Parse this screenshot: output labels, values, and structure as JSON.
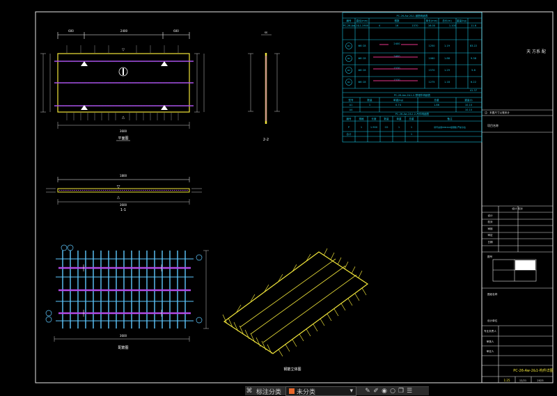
{
  "drawing": {
    "view_titles": {
      "plan": "平面图",
      "section_22": "2-2",
      "section_11": "1-1",
      "rebar_plan": "配筋图",
      "iso": "钢筋立体图"
    },
    "plan_dims": {
      "top_left": "600",
      "top_mid": "2400",
      "top_right": "600",
      "bottom": "3600"
    },
    "section_11_dims": {
      "top": "1800",
      "bottom": "3600"
    },
    "rebar_dims": {
      "bottom": "3600"
    },
    "right_note": "天 方系 配"
  },
  "schedule": {
    "title1": "PC-26-Aw-2&1-钢筋明细表",
    "headers1": [
      "编号",
      "直径(mm)",
      "根数",
      "单长(mm)",
      "总长(m)",
      "重量(kg)"
    ],
    "row0": [
      "PC-26-Aw-2&1-1900",
      "4",
      "16",
      "1570",
      "16.00",
      "1.100",
      "11.6"
    ],
    "rows": [
      {
        "id": "Φ1",
        "spec": "Φ8 C8",
        "len": "2400",
        "n": "1250",
        "w": "1.19",
        "x": "83.22"
      },
      {
        "id": "Φ2",
        "spec": "Φ8 C8",
        "len": "2400",
        "n": "1060",
        "w": "1.88",
        "x": "9.38"
      },
      {
        "id": "Φ3",
        "spec": "Φ8 C8",
        "len": "1570",
        "n": "1570",
        "w": "1.29",
        "x": "5.8"
      },
      {
        "id": "Φ4",
        "spec": "Φ8 C8",
        "len": "1570",
        "n": "1275",
        "w": "1.18",
        "x": "6.22"
      }
    ],
    "total": "41.37",
    "title2": "PC-26-Aw-2&1-2-预埋件明细表",
    "headers2": [
      "型号",
      "数量",
      "单重(kg)",
      "总重",
      "体积(m³)",
      "重量(t)"
    ],
    "row2": [
      "A1",
      "1",
      "0.74",
      "1.86",
      "1.86",
      "10.10"
    ],
    "row2b": [
      "A4",
      "",
      "",
      "",
      "",
      "10.10"
    ],
    "title3": "PC-26-Aw-2&1-2-吊件明细表",
    "headers3": [
      "编号",
      "规格",
      "长度",
      "数量",
      "单重",
      "总重",
      "备注"
    ],
    "row3": [
      "P",
      "1",
      "1.900",
      "C0",
      "1",
      "1",
      "吊环采用HPB300级钢筋,严禁冷拉"
    ],
    "row3b": [
      "合计",
      "",
      "",
      "",
      "",
      "1",
      ""
    ]
  },
  "title_block": {
    "note": "注：本图尺寸以毫米计",
    "project_label": "项目名称",
    "sheet_title": "图纸名称",
    "status": "设计 校对",
    "rows": [
      "设计",
      "校对",
      "审核",
      "审定",
      "日期"
    ],
    "small_label": "图号",
    "company": "设计单位",
    "drawn_by": "专业负责人",
    "checked_by": "审核人",
    "approved_by": "审定人",
    "drawing_no": "PC-26-Aw-2&1-构件详图",
    "scale": "1:25",
    "sheet": "12/21",
    "date": "2023"
  },
  "toolbar": {
    "classify_label": "标注分类",
    "unclassified_label": "未分类",
    "icons": [
      "classify-icon",
      "dropdown-icon",
      "edit-icon",
      "brush-icon",
      "eye-icon",
      "circle-icon",
      "copy-icon",
      "layers-icon"
    ]
  },
  "colors": {
    "bg": "#000000",
    "dim": "#ffffff",
    "rebar": "#b24ae6",
    "bar": "#5ec8ff",
    "outline": "#f2e63a",
    "table": "#18c6e6",
    "title_accent": "#f2e63a",
    "toolbar_swatch": "#e8672b"
  }
}
